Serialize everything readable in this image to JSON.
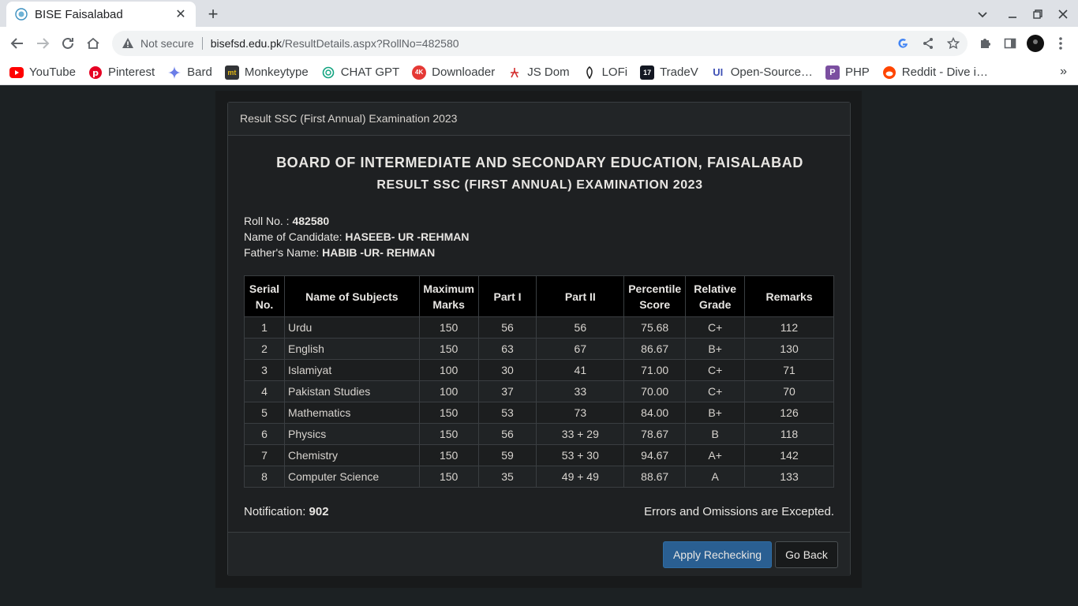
{
  "browser": {
    "tab_title": "BISE Faisalabad",
    "security_label": "Not secure",
    "url_host": "bisefsd.edu.pk",
    "url_path": "/ResultDetails.aspx?RollNo=482580",
    "tab_favicon_icon": "seal-icon",
    "bookmarks": [
      {
        "label": "YouTube",
        "icon": "youtube-icon",
        "color": "#ff0000"
      },
      {
        "label": "Pinterest",
        "icon": "pinterest-icon",
        "color": "#e60023"
      },
      {
        "label": "Bard",
        "icon": "bard-sparkle-icon",
        "color": "#4285f4"
      },
      {
        "label": "Monkeytype",
        "icon": "monkeytype-icon",
        "color": "#323437"
      },
      {
        "label": "CHAT GPT",
        "icon": "openai-icon",
        "color": "#10a37f"
      },
      {
        "label": "Downloader",
        "icon": "downloader-4k-icon",
        "color": "#e53935"
      },
      {
        "label": "JS Dom",
        "icon": "jsdom-icon",
        "color": "#d32f2f"
      },
      {
        "label": "LOFi",
        "icon": "lofi-icon",
        "color": "#222222"
      },
      {
        "label": "TradeV",
        "icon": "tradingview-icon",
        "color": "#131722"
      },
      {
        "label": "Open-Source…",
        "icon": "ui-icon",
        "color": "#3f51b5"
      },
      {
        "label": "PHP",
        "icon": "php-icon",
        "color": "#7b4fa0"
      },
      {
        "label": "Reddit - Dive i…",
        "icon": "reddit-icon",
        "color": "#ff4500"
      }
    ]
  },
  "panel": {
    "heading": "Result SSC (First Annual) Examination 2023",
    "board_title": "BOARD OF INTERMEDIATE AND SECONDARY EDUCATION, FAISALABAD",
    "exam_title": "RESULT SSC (FIRST ANNUAL) EXAMINATION 2023"
  },
  "candidate": {
    "roll_label": "Roll No. : ",
    "roll_value": "482580",
    "name_label": "Name of Candidate: ",
    "name_value": "HASEEB- UR -REHMAN",
    "father_label": "Father's Name: ",
    "father_value": "HABIB -UR- REHMAN"
  },
  "table": {
    "headers": [
      "Serial No.",
      "Name of Subjects",
      "Maximum Marks",
      "Part I",
      "Part II",
      "Percentile Score",
      "Relative Grade",
      "Remarks"
    ],
    "rows": [
      [
        "1",
        "Urdu",
        "150",
        "56",
        "56",
        "75.68",
        "C+",
        "112"
      ],
      [
        "2",
        "English",
        "150",
        "63",
        "67",
        "86.67",
        "B+",
        "130"
      ],
      [
        "3",
        "Islamiyat",
        "100",
        "30",
        "41",
        "71.00",
        "C+",
        "71"
      ],
      [
        "4",
        "Pakistan Studies",
        "100",
        "37",
        "33",
        "70.00",
        "C+",
        "70"
      ],
      [
        "5",
        "Mathematics",
        "150",
        "53",
        "73",
        "84.00",
        "B+",
        "126"
      ],
      [
        "6",
        "Physics",
        "150",
        "56",
        "33 + 29",
        "78.67",
        "B",
        "118"
      ],
      [
        "7",
        "Chemistry",
        "150",
        "59",
        "53 + 30",
        "94.67",
        "A+",
        "142"
      ],
      [
        "8",
        "Computer Science",
        "150",
        "35",
        "49 + 49",
        "88.67",
        "A",
        "133"
      ]
    ]
  },
  "notification": {
    "label": "Notification: ",
    "value": "902"
  },
  "errors_text": "Errors and Omissions are Excepted.",
  "buttons": {
    "recheck": "Apply Rechecking",
    "back": "Go Back"
  }
}
